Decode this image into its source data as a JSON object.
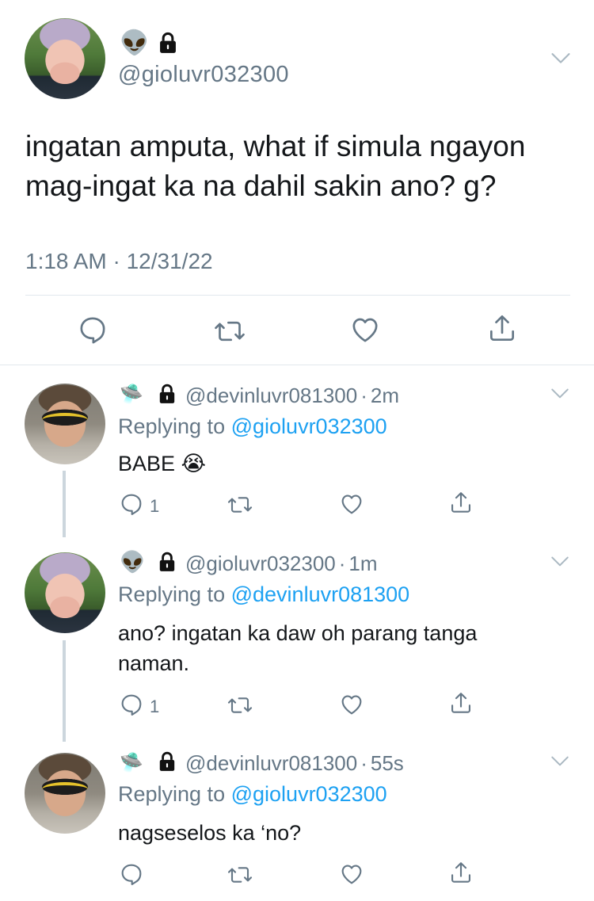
{
  "main_tweet": {
    "badge_emoji": "👽",
    "handle": "@gioluvr032300",
    "text": "ingatan amputa, what if simula ngayon mag-ingat ka na dahil sakin ano? g?",
    "timestamp": "1:18 AM · 12/31/22",
    "icons": [
      "reply-icon",
      "retweet-icon",
      "like-icon",
      "share-icon"
    ]
  },
  "replies": [
    {
      "badge_emoji": "🛸",
      "handle": "@devinluvr081300",
      "time": "2m",
      "replying_label": "Replying to",
      "replying_to": "@gioluvr032300",
      "text": "BABE 😭",
      "reply_count": "1"
    },
    {
      "badge_emoji": "👽",
      "handle": "@gioluvr032300",
      "time": "1m",
      "replying_label": "Replying to",
      "replying_to": "@devinluvr081300",
      "text": "ano? ingatan ka daw oh parang tanga naman.",
      "reply_count": "1"
    },
    {
      "badge_emoji": "🛸",
      "handle": "@devinluvr081300",
      "time": "55s",
      "replying_label": "Replying to",
      "replying_to": "@gioluvr032300",
      "text": "nagseselos ka ‘no?",
      "reply_count": ""
    }
  ],
  "separator": "·",
  "colors": {
    "text": "#14171a",
    "secondary": "#657786",
    "link": "#1da1f2",
    "divider": "#e1e8ed",
    "thread_line": "#ccd6dd"
  }
}
